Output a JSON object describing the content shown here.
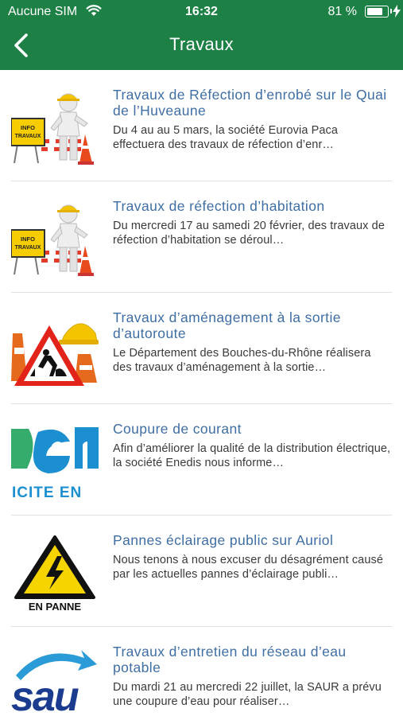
{
  "status": {
    "carrier": "Aucune SIM",
    "time": "16:32",
    "battery_pct": "81 %",
    "battery_level": 0.81
  },
  "nav": {
    "title": "Travaux",
    "back_icon": "chevron-left-icon"
  },
  "colors": {
    "header_bg": "#1d8045",
    "title_link": "#3f6ea3",
    "body_text": "#3a3a3a"
  },
  "items": [
    {
      "title": "Travaux de Réfection d’enrobé sur le Quai de l’Huveaune",
      "desc": "Du 4 au au 5 mars, la société Eurovia Paca effectuera des travaux de réfection d’enr…",
      "image": "worker-info-travaux",
      "sign_line1": "INFO",
      "sign_line2": "TRAVAUX"
    },
    {
      "title": "Travaux de réfection d’habitation",
      "desc": "Du mercredi 17 au samedi 20 février, des travaux de réfection d’habitation se déroul…",
      "image": "worker-info-travaux",
      "sign_line1": "INFO",
      "sign_line2": "TRAVAUX"
    },
    {
      "title": "Travaux d’aménagement à la sortie d’autoroute",
      "desc": "Le Département des Bouches-du-Rhône réalisera des travaux d’aménagement à la sortie…",
      "image": "roadwork-sign-helmet"
    },
    {
      "title": "Coupure de courant",
      "desc": "Afin d’améliorer la qualité de la distribution électrique, la société Enedis nous informe…",
      "image": "enedis-logo",
      "logo_text": "ICITE EN"
    },
    {
      "title": "Pannes éclairage public sur Auriol",
      "desc": "Nous tenons à nous excuser du désagrément causé par les actuelles pannes d’éclairage publi…",
      "image": "high-voltage-warning",
      "caption": "EN PANNE"
    },
    {
      "title": "Travaux d’entretien du réseau d’eau potable",
      "desc": "Du mardi 21 au mercredi 22 juillet, la SAUR a prévu une coupure d’eau pour réaliser…",
      "image": "saur-logo",
      "logo_text": "sau"
    }
  ]
}
